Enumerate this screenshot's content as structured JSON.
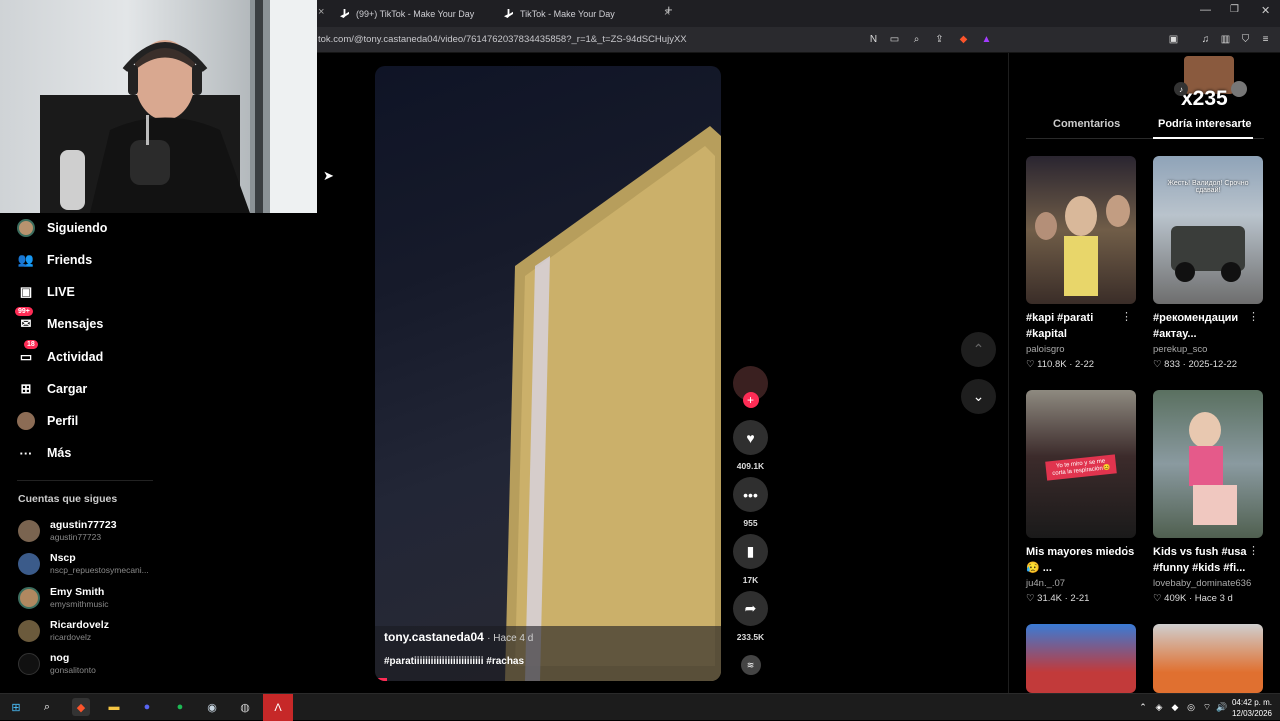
{
  "browser": {
    "tabs": [
      {
        "label": "(99+) TikTok - Make Your Day"
      },
      {
        "label": "TikTok - Make Your Day"
      }
    ],
    "url": "tok.com/@tony.castaneda04/video/7614762037834435858?_r=1&_t=ZS-94dSCHujyXX"
  },
  "sidebar": {
    "items": [
      {
        "label": "Siguiendo",
        "icon": "avatar-icon"
      },
      {
        "label": "Friends",
        "icon": "friends-icon"
      },
      {
        "label": "LIVE",
        "icon": "live-icon"
      },
      {
        "label": "Mensajes",
        "icon": "message-icon",
        "badge": "99+"
      },
      {
        "label": "Actividad",
        "icon": "activity-icon",
        "badge": "18"
      },
      {
        "label": "Cargar",
        "icon": "upload-icon"
      },
      {
        "label": "Perfil",
        "icon": "profile-icon"
      },
      {
        "label": "Más",
        "icon": "more-icon"
      }
    ],
    "following_title": "Cuentas que sigues",
    "accounts": [
      {
        "name": "agustin77723",
        "handle": "agustin77723"
      },
      {
        "name": "Nscp",
        "handle": "nscp_repuestosymecani..."
      },
      {
        "name": "Emy Smith",
        "handle": "emysmithmusic"
      },
      {
        "name": "Ricardovelz",
        "handle": "ricardovelz"
      },
      {
        "name": "nog",
        "handle": "gonsalitonto"
      }
    ]
  },
  "video": {
    "author": "tony.castaneda04",
    "time": "· Hace 4 d",
    "caption": "#paratiiiiiiiiiiiiiiiiiiiiiiiii #rachas"
  },
  "actions": {
    "likes": "409.1K",
    "comments": "955",
    "saves": "17K",
    "shares": "233.5K"
  },
  "right_panel": {
    "tabs": [
      "Comentarios",
      "Podría interesarte"
    ],
    "overlay_text": "x235",
    "cards": [
      {
        "title": "#kapi #parati #kapital",
        "author": "paloisgro",
        "stats": "♡ 110.8K · 2-22"
      },
      {
        "title": "#рекомендации #актау...",
        "author": "perekup_sco",
        "stats": "♡ 833 · 2025-12-22"
      },
      {
        "title": "Mis mayores miedos😥 ...",
        "author": "ju4n._.07",
        "stats": "♡ 31.4K · 2-21"
      },
      {
        "title": "Kids vs fush #usa #funny #kids #fi...",
        "author": "lovebaby_dominate636",
        "stats": "♡ 409K · Hace 3 d"
      }
    ],
    "thumb_texts": [
      "Жесть! Валидол! Срочно сдавай!",
      "Yo te miro y se me corta la respiración😊"
    ]
  },
  "taskbar": {
    "time": "04:42 p. m.",
    "date": "12/03/2026"
  },
  "colors": {
    "accent": "#fe2c55",
    "bg": "#000000"
  }
}
